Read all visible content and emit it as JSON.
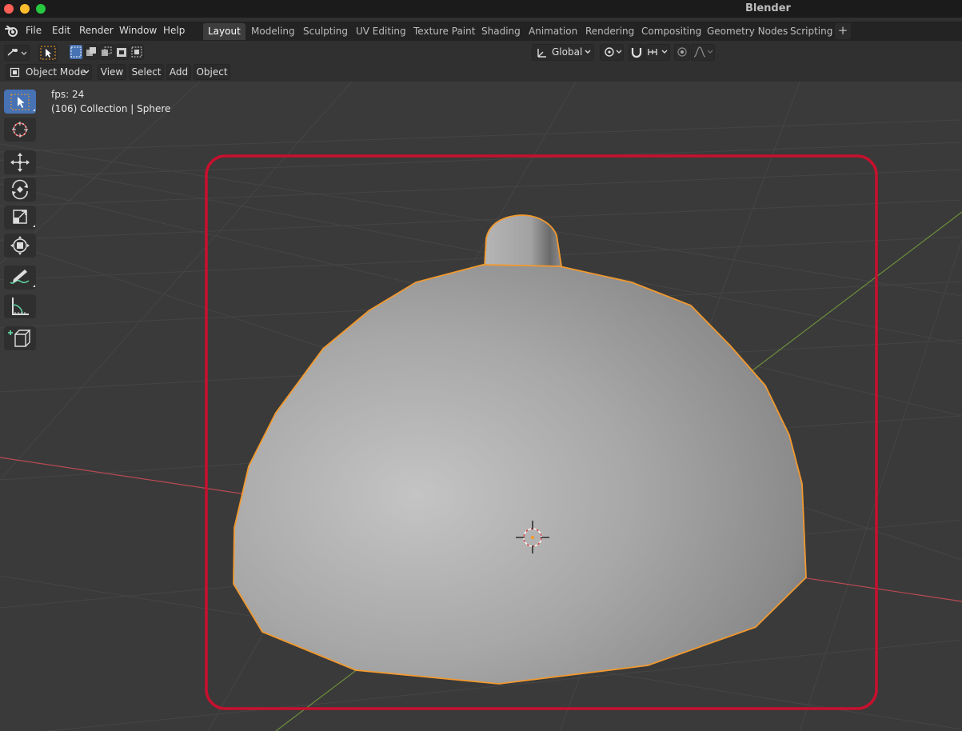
{
  "app": {
    "title": "Blender"
  },
  "menubar": {
    "items": [
      "File",
      "Edit",
      "Render",
      "Window",
      "Help"
    ]
  },
  "workspaces": {
    "tabs": [
      "Layout",
      "Modeling",
      "Sculpting",
      "UV Editing",
      "Texture Paint",
      "Shading",
      "Animation",
      "Rendering",
      "Compositing",
      "Geometry Nodes",
      "Scripting"
    ],
    "active": "Layout",
    "add_label": "+"
  },
  "toolheader": {
    "transform_orientation": "Global"
  },
  "header": {
    "mode": "Object Mode",
    "menus": [
      "View",
      "Select",
      "Add",
      "Object"
    ]
  },
  "viewport": {
    "fps_text": "fps: 24",
    "collection_text": "(106) Collection | Sphere",
    "colors": {
      "selection_outline": "#f2992e",
      "highlight_box": "#c8102e",
      "x_axis": "#b84a52",
      "y_axis": "#6e8e3c",
      "active_tool": "#4772b3"
    }
  },
  "toolbar": {
    "tools": [
      "select-box-icon",
      "cursor-icon",
      "move-icon",
      "rotate-icon",
      "scale-icon",
      "transform-icon",
      "annotate-icon",
      "measure-icon",
      "add-cube-icon"
    ],
    "active": "select-box-icon"
  }
}
